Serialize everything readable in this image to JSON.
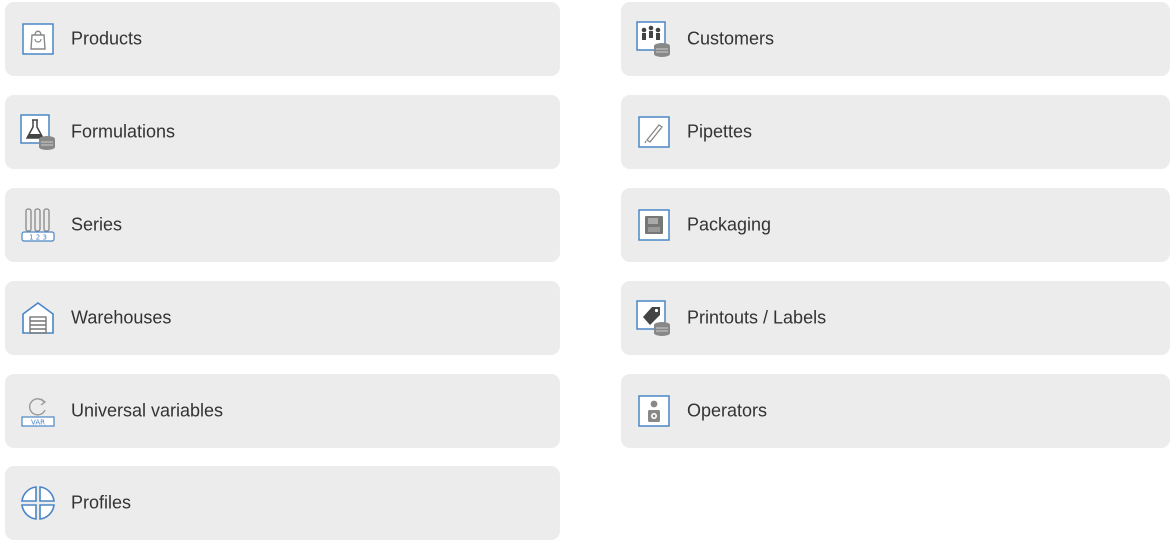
{
  "menu": {
    "left": [
      {
        "label": "Products",
        "icon": "shopping-bag-icon"
      },
      {
        "label": "Formulations",
        "icon": "flask-database-icon"
      },
      {
        "label": "Series",
        "icon": "test-tubes-icon"
      },
      {
        "label": "Warehouses",
        "icon": "warehouse-icon"
      },
      {
        "label": "Universal variables",
        "icon": "refresh-var-icon"
      },
      {
        "label": "Profiles",
        "icon": "profiles-icon"
      }
    ],
    "right": [
      {
        "label": "Customers",
        "icon": "customers-database-icon"
      },
      {
        "label": "Pipettes",
        "icon": "pipette-icon"
      },
      {
        "label": "Packaging",
        "icon": "package-icon"
      },
      {
        "label": "Printouts / Labels",
        "icon": "label-tag-database-icon"
      },
      {
        "label": "Operators",
        "icon": "operator-icon"
      }
    ],
    "series_icon_text": "1 2 3",
    "var_icon_text": "VAR"
  },
  "colors": {
    "tile_background": "#ececec",
    "icon_accent": "#4a86c5",
    "icon_dark": "#5a5a5a",
    "text": "#333333"
  }
}
